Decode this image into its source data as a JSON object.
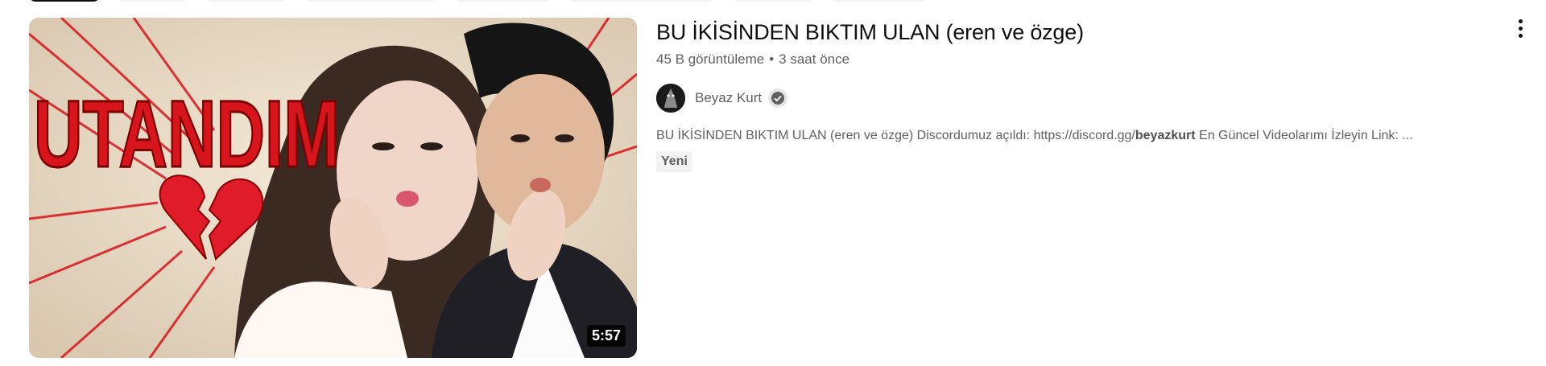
{
  "video": {
    "thumbnail_text": "UTANDIM",
    "duration": "5:57",
    "title": "BU İKİSİNDEN BIKTIM ULAN (eren ve özge)",
    "views": "45 B görüntüleme",
    "separator": "•",
    "age": "3 saat önce",
    "channel": {
      "name": "Beyaz Kurt",
      "verified_icon": "verified-check-icon"
    },
    "description_prefix": "BU İKİSİNDEN BIKTIM ULAN (eren ve özge) Discordumuz açıldı: https://discord.gg/",
    "description_bold": "beyazkurt",
    "description_suffix": " En Güncel Videolarımı İzleyin Link: ...",
    "badge": "Yeni",
    "more_icon": "more-vert-icon"
  },
  "colors": {
    "title": "#0f0f0f",
    "secondary_text": "#606060",
    "badge_bg": "#f2f2f2",
    "thumbnail_red": "#d8141c"
  }
}
